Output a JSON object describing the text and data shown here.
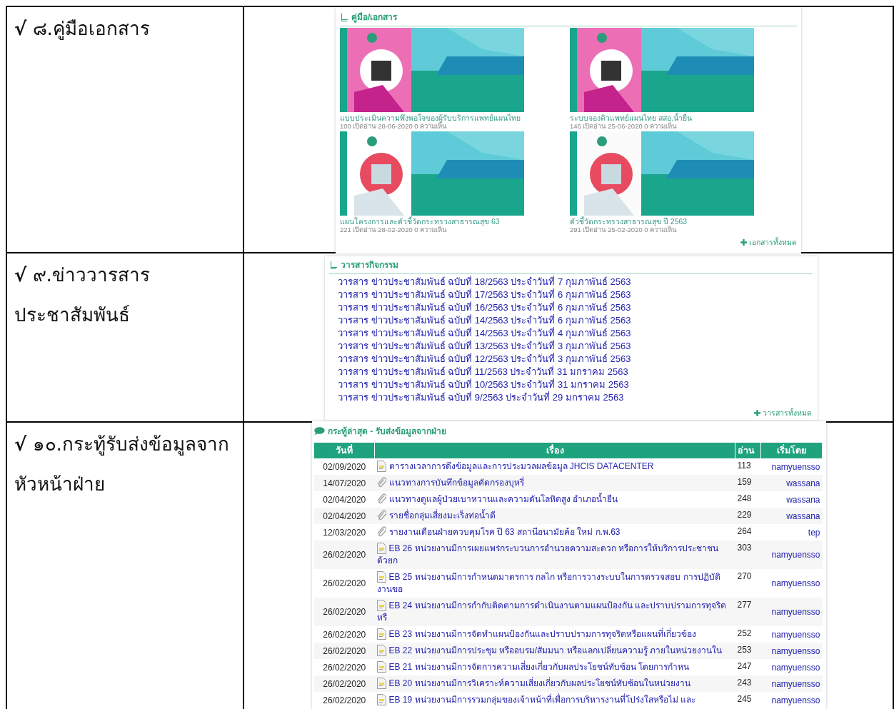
{
  "document_table": {
    "rows": [
      {
        "lines": [
          "**√** ๘.คู่มือเอกสาร"
        ]
      },
      {
        "lines": [
          "**√** ๙.ข่าววารสาร",
          "ประชาสัมพันธ์"
        ]
      },
      {
        "lines": [
          "**√** ๑๐.กระทู้รับส่งข้อมูลจาก",
          "หัวหน้าฝ่าย"
        ]
      }
    ]
  },
  "handbook_panel": {
    "title": "คู่มือ/เอกสาร",
    "items": [
      {
        "kind": "picture",
        "title": "แบบประเมินความพึงพอใจของผู้รับบริการแพทย์แผนไทย",
        "meta": "100 เปิดอ่าน 28-06-2020 0 ความเห็น"
      },
      {
        "kind": "picture",
        "title": "ระบบจองคิวแพทย์แผนไทย สสอ.น้ำยืน",
        "meta": "146 เปิดอ่าน 25-06-2020 0 ความเห็น"
      },
      {
        "kind": "picture",
        "title": "แผนโครงการและตัวชี้วัดกระทรวงสาธารณสุข 63",
        "meta": "221 เปิดอ่าน 28-02-2020 0 ความเห็น"
      },
      {
        "kind": "picture",
        "title": "ตัวชี้วัดกระทรวงสาธารณสุข ปี 2563",
        "meta": "291 เปิดอ่าน 25-02-2020 0 ความเห็น"
      }
    ],
    "more_link": "เอกสารทั้งหมด"
  },
  "journal_panel": {
    "title": "วารสารกิจกรรม",
    "links": [
      "วารสาร ข่าวประชาสัมพันธ์ ฉบับที่ 18/2563 ประจำวันที่ 7 กุมภาพันธ์ 2563",
      "วารสาร ข่าวประชาสัมพันธ์ ฉบับที่ 17/2563 ประจำวันที่ 6 กุมภาพันธ์ 2563",
      "วารสาร ข่าวประชาสัมพันธ์ ฉบับที่ 16/2563 ประจำวันที่ 6 กุมภาพันธ์ 2563",
      "วารสาร ข่าวประชาสัมพันธ์ ฉบับที่ 14/2563 ประจำวันที่ 6 กุมภาพันธ์ 2563",
      "วารสาร ข่าวประชาสัมพันธ์ ฉบับที่ 14/2563 ประจำวันที่ 4 กุมภาพันธ์ 2563",
      "วารสาร ข่าวประชาสัมพันธ์ ฉบับที่ 13/2563 ประจำวันที่ 3 กุมภาพันธ์ 2563",
      "วารสาร ข่าวประชาสัมพันธ์ ฉบับที่ 12/2563 ประจำวันที่ 3 กุมภาพันธ์ 2563",
      "วารสาร ข่าวประชาสัมพันธ์ ฉบับที่ 11/2563 ประจำวันที่ 31 มกราคม 2563",
      "วารสาร ข่าวประชาสัมพันธ์ ฉบับที่ 10/2563 ประจำวันที่ 31 มกราคม 2563",
      "วารสาร ข่าวประชาสัมพันธ์ ฉบับที่ 9/2563 ประจำวันที่ 29 มกราคม 2563"
    ],
    "more_link": "วารสารทั้งหมด"
  },
  "forum_panel": {
    "title": "กระทู้ล่าสุด - รับส่งข้อมูลจากฝ่าย",
    "columns": [
      "วันที่",
      "เรื่อง",
      "อ่าน",
      "เริ่มโดย"
    ],
    "rows": [
      {
        "date": "02/09/2020",
        "kind": "doc",
        "title": "ตารางเวลาการดึงข้อมูลและการประมวลผลข้อมูล JHCIS DATACENTER",
        "reads": "113",
        "by": "namyuensso"
      },
      {
        "date": "14/07/2020",
        "kind": "clip",
        "title": "แนวทางการบันทึกข้อมูลคัดกรองบุหรี่",
        "reads": "159",
        "by": "wassana"
      },
      {
        "date": "02/04/2020",
        "kind": "clip",
        "title": "แนวทางดูแลผู้ป่วยเบาหวานและความดันโลหิตสูง อำเภอน้ำยืน",
        "reads": "248",
        "by": "wassana"
      },
      {
        "date": "02/04/2020",
        "kind": "clip",
        "title": "รายชื่อกลุ่มเสี่ยงมะเร็งท่อน้ำดี",
        "reads": "229",
        "by": "wassana"
      },
      {
        "date": "12/03/2020",
        "kind": "clip",
        "title": "รายงานเดือนฝ่ายควบคุมโรค ปี 63 สถานีอนามัยค้อ ใหม่ ก.พ.63",
        "reads": "264",
        "by": "tep"
      },
      {
        "date": "26/02/2020",
        "kind": "doc",
        "title": "EB 26 หน่วยงานมีการเผยแพร่กระบวนการอำนวยความสะดวก หรือการให้บริการประชาชนด้วยก",
        "reads": "303",
        "by": "namyuensso"
      },
      {
        "date": "26/02/2020",
        "kind": "doc",
        "title": "EB 25 หน่วยงานมีการกำหนดมาตรการ กลไก หรือการวางระบบในการตรวจสอบ การปฏิบัติงานขอ",
        "reads": "270",
        "by": "namyuensso"
      },
      {
        "date": "26/02/2020",
        "kind": "doc",
        "title": "EB 24 หน่วยงานมีการกำกับติดตามการดำเนินงานตามแผนป้องกัน และปราบปรามการทุจริตหรื",
        "reads": "277",
        "by": "namyuensso"
      },
      {
        "date": "26/02/2020",
        "kind": "doc",
        "title": "EB 23 หน่วยงานมีการจัดทำแผนป้องกันและปราบปรามการทุจริตหรือแผนที่เกี่ยวข้อง",
        "reads": "252",
        "by": "namyuensso"
      },
      {
        "date": "26/02/2020",
        "kind": "doc",
        "title": "EB 22 หน่วยงานมีการประชุม หรืออบรม/สัมมนา หรือแลกเปลี่ยนความรู้ ภายในหน่วยงานใน",
        "reads": "253",
        "by": "namyuensso"
      },
      {
        "date": "26/02/2020",
        "kind": "doc",
        "title": "EB 21 หน่วยงานมีการจัดการความเสี่ยงเกี่ยวกับผลประโยชน์ทับซ้อน โดยการกำหน",
        "reads": "247",
        "by": "namyuensso"
      },
      {
        "date": "26/02/2020",
        "kind": "doc",
        "title": "EB 20 หน่วยงานมีการวิเคราะห์ความเสี่ยงเกี่ยวกับผลประโยชน์ทับซ้อนในหน่วยงาน",
        "reads": "243",
        "by": "namyuensso"
      },
      {
        "date": "26/02/2020",
        "kind": "doc",
        "title": "EB 19 หน่วยงานมีการรวมกลุ่มของเจ้าหน้าที่เพื่อการบริหารงานที่โปร่งใสหรือไม่ และ",
        "reads": "245",
        "by": "namyuensso"
      }
    ]
  }
}
